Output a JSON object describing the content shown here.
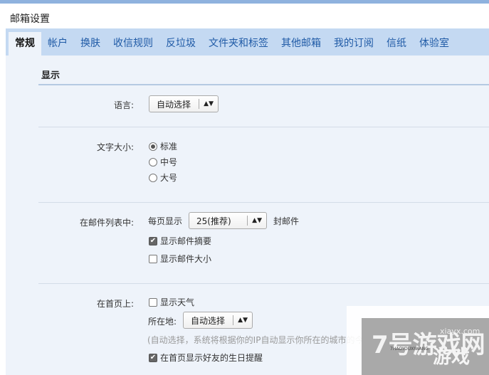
{
  "title": "邮箱设置",
  "tabs": [
    {
      "label": "常规",
      "active": true
    },
    {
      "label": "帐户"
    },
    {
      "label": "换肤"
    },
    {
      "label": "收信规则"
    },
    {
      "label": "反垃圾"
    },
    {
      "label": "文件夹和标签"
    },
    {
      "label": "其他邮箱"
    },
    {
      "label": "我的订阅"
    },
    {
      "label": "信纸"
    },
    {
      "label": "体验室"
    }
  ],
  "section": "显示",
  "language": {
    "label": "语言:",
    "value": "自动选择"
  },
  "font_size": {
    "label": "文字大小:",
    "options": [
      {
        "label": "标准",
        "checked": true
      },
      {
        "label": "中号",
        "checked": false
      },
      {
        "label": "大号",
        "checked": false
      }
    ]
  },
  "mail_list": {
    "label": "在邮件列表中:",
    "per_page_prefix": "每页显示",
    "per_page_value": "25(推荐)",
    "per_page_suffix": "封邮件",
    "show_summary": {
      "label": "显示邮件摘要",
      "checked": true
    },
    "show_size": {
      "label": "显示邮件大小",
      "checked": false
    }
  },
  "homepage": {
    "label": "在首页上:",
    "show_weather": {
      "label": "显示天气",
      "checked": false
    },
    "location_label": "所在地:",
    "location_value": "自动选择",
    "hint": "(自动选择，系统将根据你的IP自动显示你所在的城市的今明",
    "birthday": {
      "label": "在首页显示好友的生日提醒",
      "checked": true
    }
  },
  "watermark": {
    "text": "7号游戏网",
    "url": "xiayx.com",
    "pinyin": "7HAOYOUXIWANG",
    "game": "游戏"
  },
  "colors": {
    "tab_bar": "#c4d9f2",
    "content_bg": "#eef3fa",
    "tab_text": "#1f5aa6"
  }
}
